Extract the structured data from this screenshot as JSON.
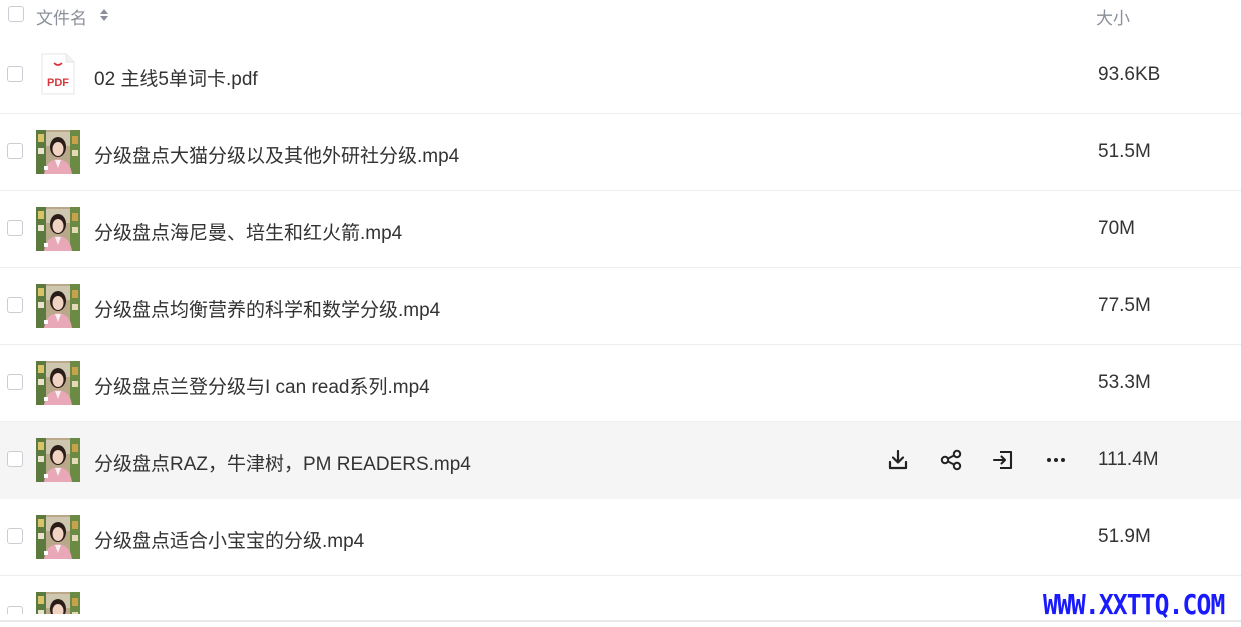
{
  "header": {
    "name_label": "文件名",
    "size_label": "大小"
  },
  "files": [
    {
      "name": "02 主线5单词卡.pdf",
      "size": "93.6KB",
      "type": "pdf",
      "icon": "pdf-file-icon"
    },
    {
      "name": "分级盘点大猫分级以及其他外研社分级.mp4",
      "size": "51.5M",
      "type": "video",
      "icon": "video-thumbnail"
    },
    {
      "name": "分级盘点海尼曼、培生和红火箭.mp4",
      "size": "70M",
      "type": "video",
      "icon": "video-thumbnail"
    },
    {
      "name": "分级盘点均衡营养的科学和数学分级.mp4",
      "size": "77.5M",
      "type": "video",
      "icon": "video-thumbnail"
    },
    {
      "name": "分级盘点兰登分级与I can read系列.mp4",
      "size": "53.3M",
      "type": "video",
      "icon": "video-thumbnail"
    },
    {
      "name": "分级盘点RAZ，牛津树，PM READERS.mp4",
      "size": "111.4M",
      "type": "video",
      "icon": "video-thumbnail",
      "hovered": true
    },
    {
      "name": "分级盘点适合小宝宝的分级.mp4",
      "size": "51.9M",
      "type": "video",
      "icon": "video-thumbnail"
    }
  ],
  "row_actions": [
    "download-icon",
    "share-icon",
    "move-icon",
    "more-icon"
  ],
  "pdf_badge": "PDF",
  "watermark": "WWW.XXTTQ.COM",
  "colors": {
    "hover_row": "#f5f5f6",
    "watermark": "#1a1aff",
    "pdf_red": "#d9363e"
  }
}
